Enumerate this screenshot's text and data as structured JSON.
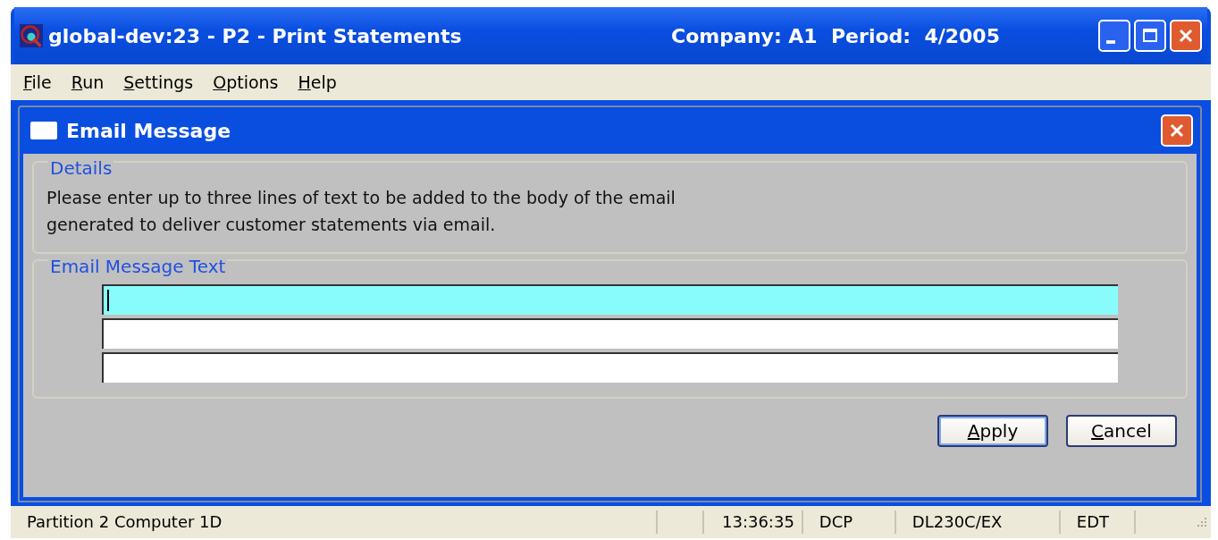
{
  "window": {
    "title": "global-dev:23 - P2 - Print Statements",
    "context": "Company: A1  Period:  4/2005"
  },
  "menu": [
    {
      "label": "File"
    },
    {
      "label": "Run"
    },
    {
      "label": "Settings"
    },
    {
      "label": "Options"
    },
    {
      "label": "Help"
    }
  ],
  "dialog": {
    "title": "Email Message",
    "details": {
      "legend": "Details",
      "lines": [
        "Please enter up to three lines of text to be added to the body of the email",
        "generated to deliver customer statements via email."
      ]
    },
    "message": {
      "legend": "Email Message Text",
      "fields": [
        {
          "focused": true
        },
        {
          "focused": false
        },
        {
          "focused": false
        }
      ]
    },
    "buttons": [
      {
        "label": "Apply",
        "default": true
      },
      {
        "label": "Cancel",
        "default": false
      }
    ]
  },
  "status_bar": [
    "Partition 2 Computer 1D",
    "13:36:35",
    "DCP",
    "DL230C/EX",
    "EDT"
  ]
}
